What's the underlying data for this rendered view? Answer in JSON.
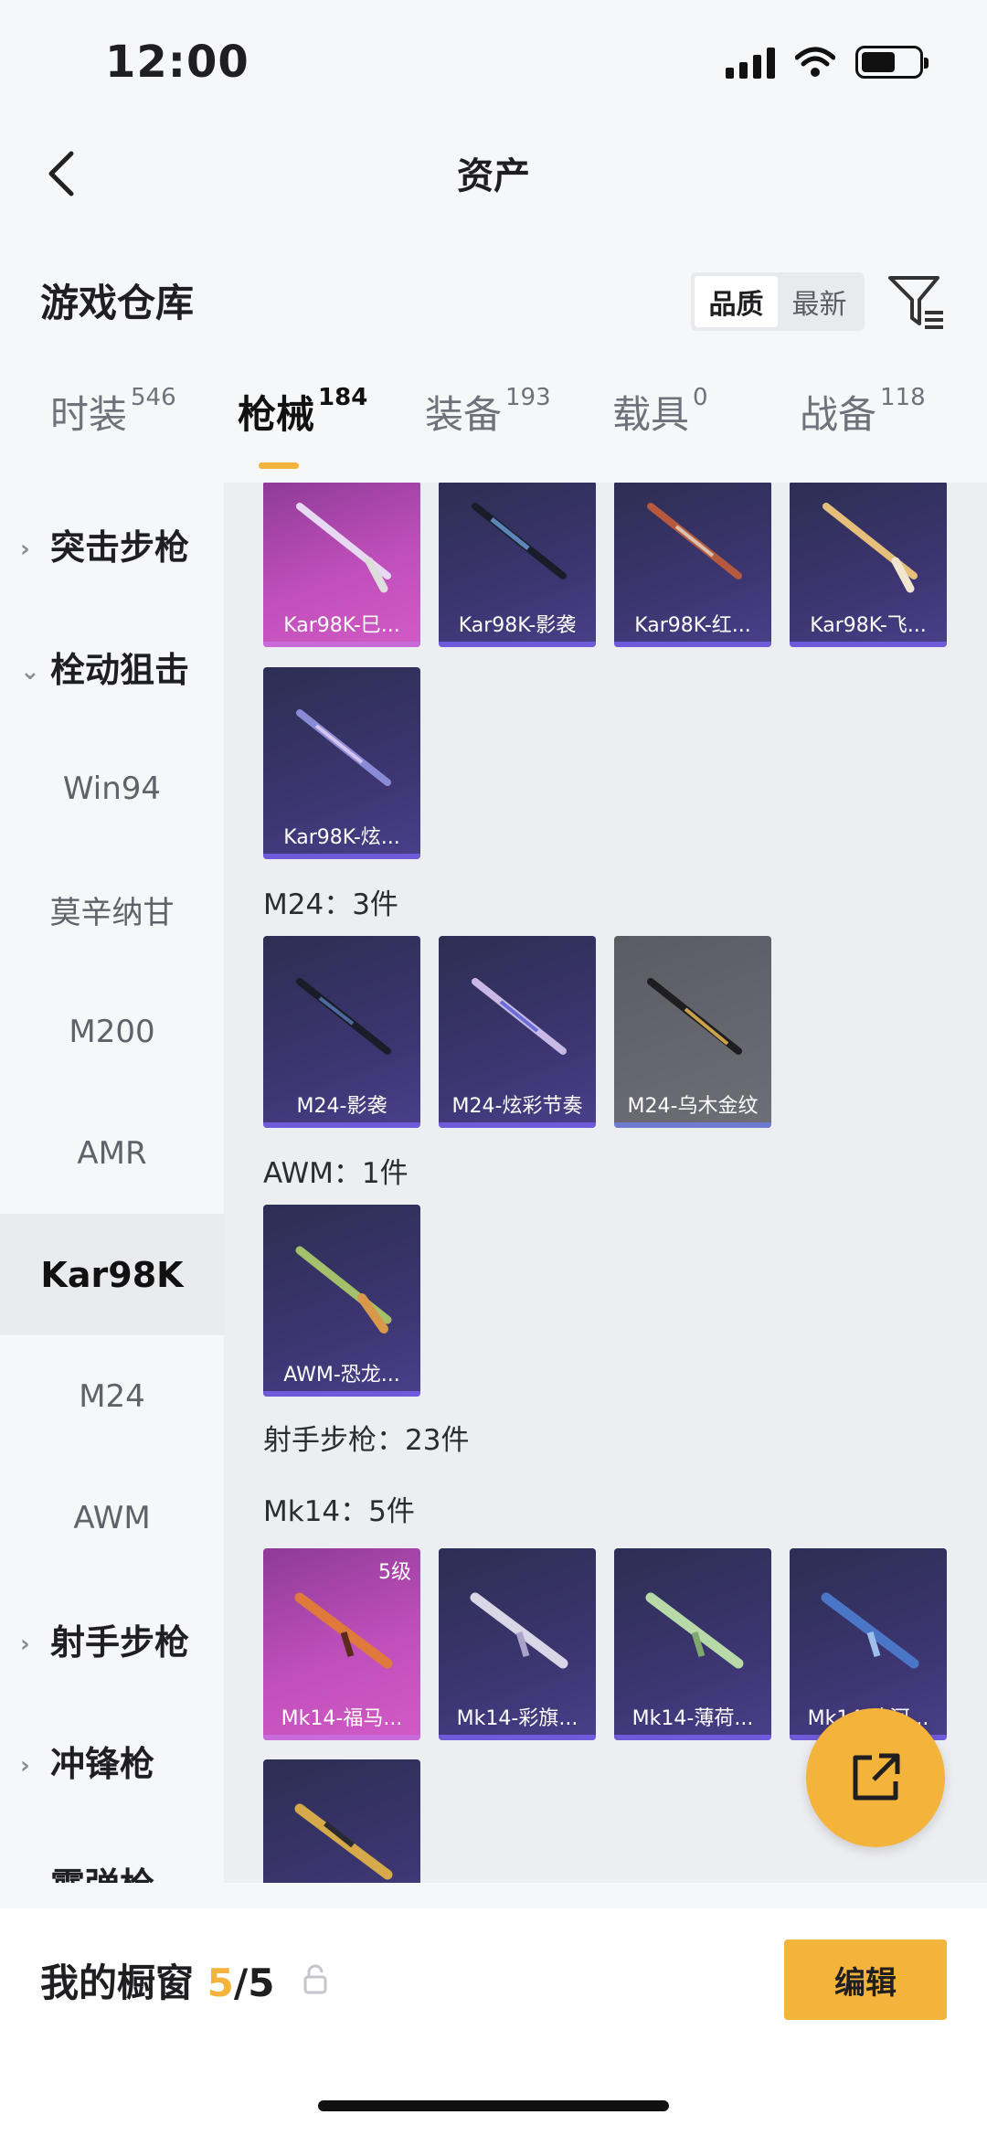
{
  "status": {
    "time": "12:00"
  },
  "nav": {
    "title": "资产"
  },
  "warehouse": {
    "title": "游戏仓库",
    "sort_options": [
      "品质",
      "最新"
    ],
    "sort_selected": "品质"
  },
  "tabs": [
    {
      "label": "时装",
      "count": "546"
    },
    {
      "label": "枪械",
      "count": "184",
      "active": true
    },
    {
      "label": "装备",
      "count": "193"
    },
    {
      "label": "载具",
      "count": "0"
    },
    {
      "label": "战备",
      "count": "118"
    }
  ],
  "sidebar": {
    "items": [
      {
        "label": "突击步枪",
        "type": "group",
        "expanded": false
      },
      {
        "label": "栓动狙击",
        "type": "group",
        "expanded": true
      },
      {
        "label": "Win94",
        "type": "sub"
      },
      {
        "label": "莫辛纳甘",
        "type": "sub"
      },
      {
        "label": "M200",
        "type": "sub"
      },
      {
        "label": "AMR",
        "type": "sub"
      },
      {
        "label": "Kar98K",
        "type": "sub",
        "selected": true
      },
      {
        "label": "M24",
        "type": "sub"
      },
      {
        "label": "AWM",
        "type": "sub"
      },
      {
        "label": "射手步枪",
        "type": "group",
        "expanded": false
      },
      {
        "label": "冲锋枪",
        "type": "group",
        "expanded": false
      },
      {
        "label": "霰弹枪",
        "type": "group",
        "expanded": false
      }
    ]
  },
  "content": {
    "kar98k_row1": [
      "Kar98K-巳...",
      "Kar98K-影袭",
      "Kar98K-红...",
      "Kar98K-飞..."
    ],
    "kar98k_row2": [
      "Kar98K-炫..."
    ],
    "m24_header": "M24：3件",
    "m24_items": [
      "M24-影袭",
      "M24-炫彩节奏",
      "M24-乌木金纹"
    ],
    "awm_header": "AWM：1件",
    "awm_items": [
      "AWM-恐龙..."
    ],
    "dmr_header": "射手步枪：23件",
    "mk14_header": "Mk14：5件",
    "mk14_items": [
      "Mk14-福马...",
      "Mk14-彩旗...",
      "Mk14-薄荷...",
      "Mk14-冰河..."
    ],
    "mk14_level": "5级"
  },
  "bottom": {
    "showcase_label": "我的橱窗",
    "showcase_count": "5",
    "showcase_total": "/5",
    "edit_label": "编辑"
  },
  "colors": {
    "accent": "#f4b33a",
    "card_dark": "#3c3570",
    "card_pink": "#c04fbb"
  }
}
